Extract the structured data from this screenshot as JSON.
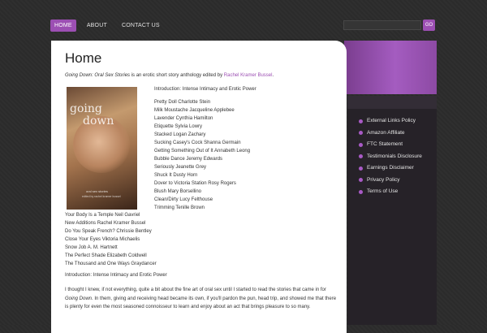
{
  "nav": {
    "items": [
      {
        "label": "HOME",
        "active": true
      },
      {
        "label": "ABOUT",
        "active": false
      },
      {
        "label": "CONTACT US",
        "active": false
      }
    ],
    "search_placeholder": "",
    "search_button_label": "GO"
  },
  "page": {
    "title": "Home",
    "intro_title": "Going Down: Oral Sex Stories",
    "intro_middle": " is an erotic short story anthology edited by ",
    "intro_link": "Rachel Kramer Bussel",
    "intro_end": ".",
    "intro_heading": "Introduction: Intense Intimacy and Erotic Power",
    "toc_right": [
      "Pretty Doll Charlotte Stein",
      "Milk Moustache Jacqueline Applebee",
      "Lavender Cynthia Hamilton",
      "Etiquette Sylvia Lowry",
      "Stacked Logan Zachary",
      "Sucking Casey's Cock Shanna Germain",
      "Getting Something Out of It Annabeth Leong",
      "Bubble Dance Jeremy Edwards",
      "Seriously Jeanette Grey",
      "Shuck It Dusty Horn",
      "Dover to Victoria Station Rosy Rogers",
      "Blush Mary Borsellino",
      "Clean/Dirty Lucy Felthouse",
      "Trimming Tenille Brown"
    ],
    "toc_left": [
      "Your Body Is a Temple Neil Gavriel",
      "New Additions Rachel Kramer Bussel",
      "Do You Speak French? Chrissie Bentley",
      "Close Your Eyes Viktoria Michaelis",
      "Snow Job A. M. Hartnett",
      "The Perfect Shade Elizabeth Coldwell",
      "The Thousand and One Ways Graydancer"
    ],
    "intro_heading_2": "Introduction: Intense Intimacy and Erotic Power",
    "body_part1": "I thought I knew, if not everything, quite a bit about the fine art of oral sex until I started to read the stories that came in for ",
    "body_em": "Going Down",
    "body_part2": ". In them, giving and receiving head became its own, if you'll pardon the pun, head trip, and showed me that there is plenty for even the most seasoned connoisseur to learn and enjoy about an act that brings pleasure to so many."
  },
  "cover": {
    "title_line1": "going",
    "title_line2": "down",
    "subtitle": "oral sex stories",
    "editor": "edited by rachel kramer bussel"
  },
  "sidebar": {
    "links": [
      "External Links Policy",
      "Amazon Affiliate",
      "FTC Statement",
      "Testimonials Disclosure",
      "Earnings Disclaimer",
      "Privacy Policy",
      "Terms of Use"
    ]
  },
  "colors": {
    "accent": "#9c4fb3",
    "background": "#2b2b2b"
  }
}
